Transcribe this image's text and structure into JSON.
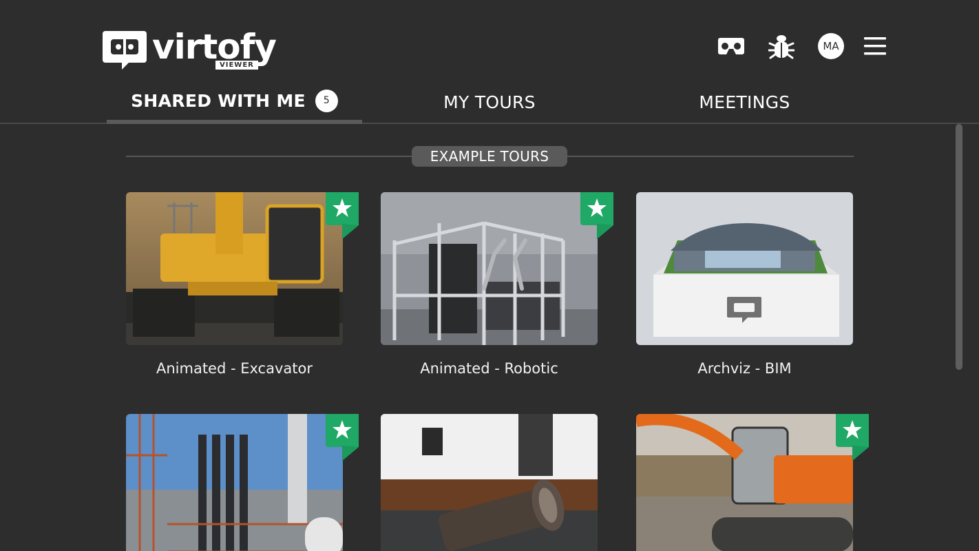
{
  "app": {
    "brand": "virtofy",
    "brand_sub": "VIEWER"
  },
  "header": {
    "icons": [
      "vr-headset-icon",
      "bug-icon",
      "menu-icon"
    ],
    "avatar_initials": "MA"
  },
  "tabs": [
    {
      "label": "SHARED WITH ME",
      "badge": "5",
      "active": true
    },
    {
      "label": "MY TOURS",
      "active": false
    },
    {
      "label": "MEETINGS",
      "active": false
    }
  ],
  "section": {
    "label": "EXAMPLE TOURS"
  },
  "tours": [
    {
      "title": "Animated - Excavator",
      "featured": true
    },
    {
      "title": "Animated - Robotic",
      "featured": true
    },
    {
      "title": "Archviz - BIM",
      "featured": false
    },
    {
      "title": "",
      "featured": true
    },
    {
      "title": "",
      "featured": false
    },
    {
      "title": "",
      "featured": true
    }
  ],
  "colors": {
    "background": "#2d2d2d",
    "featured_flag": "#1fa866",
    "section_pill": "#5a5a5a"
  }
}
